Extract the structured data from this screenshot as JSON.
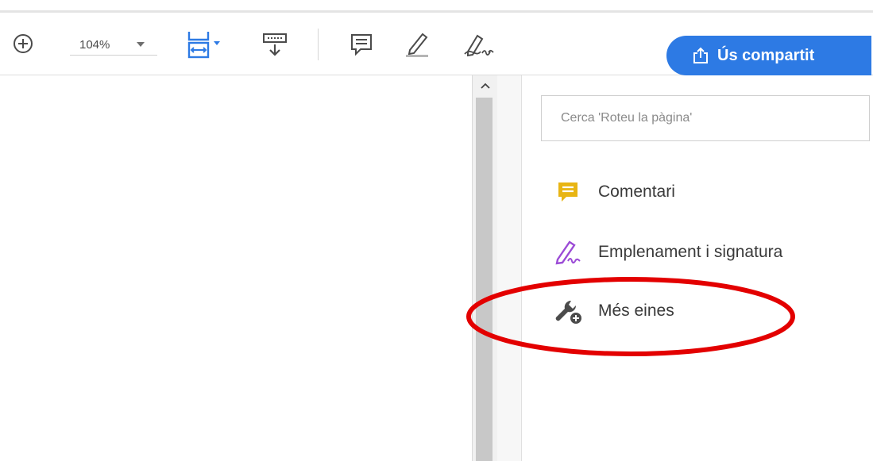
{
  "toolbar": {
    "zoom_in_icon": "zoom-in-icon",
    "zoom_value": "104%",
    "fit_width_icon": "fit-page-width-icon",
    "scroll_mode_icon": "scroll-mode-icon",
    "comment_icon": "comment-icon",
    "highlight_icon": "highlight-icon",
    "sign_icon": "sign-icon",
    "share_label": "Ús compartit",
    "share_icon": "share-upload-icon",
    "share_color": "#2d7ae4"
  },
  "tools_pane": {
    "search_placeholder": "Cerca 'Roteu la pàgina'",
    "items": [
      {
        "label": "Comentari",
        "icon": "comment-tool-icon",
        "color": "#e8b513"
      },
      {
        "label": "Emplenament i signatura",
        "icon": "fill-sign-icon",
        "color": "#9b4bd6"
      },
      {
        "label": "Més eines",
        "icon": "more-tools-wrench-icon",
        "color": "#4b4b4b"
      }
    ]
  },
  "annotation": {
    "shape": "ellipse",
    "color": "#e30000",
    "target": "Més eines"
  }
}
